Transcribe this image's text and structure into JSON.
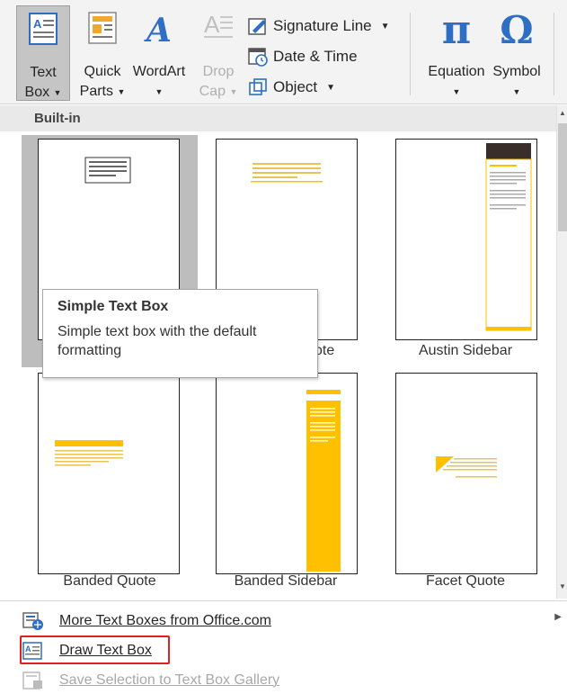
{
  "ribbon": {
    "text_box": {
      "line1": "Text",
      "line2": "Box"
    },
    "quick_parts": {
      "line1": "Quick",
      "line2": "Parts"
    },
    "wordart": {
      "line1": "WordArt"
    },
    "drop_cap": {
      "line1": "Drop",
      "line2": "Cap"
    },
    "signature_line": "Signature Line",
    "date_time": "Date & Time",
    "object": "Object",
    "equation": {
      "label": "Equation",
      "glyph": "π"
    },
    "symbol": {
      "label": "Symbol",
      "glyph": "Ω"
    }
  },
  "gallery": {
    "section_label": "Built-in",
    "tiles": [
      {
        "label": "Simple Text Box"
      },
      {
        "label": "ote"
      },
      {
        "label": "Austin Sidebar"
      },
      {
        "label": "Banded Quote"
      },
      {
        "label": "Banded Sidebar"
      },
      {
        "label": "Facet Quote"
      }
    ]
  },
  "tooltip": {
    "title": "Simple Text Box",
    "description": "Simple text box with the default formatting"
  },
  "menu": {
    "more": "More Text Boxes from Office.com",
    "draw": "Draw Text Box",
    "save": "Save Selection to Text Box Gallery"
  },
  "colors": {
    "accent_yellow": "#ffc000",
    "highlight_red": "#e02020",
    "pi_blue": "#2e6fc4"
  }
}
